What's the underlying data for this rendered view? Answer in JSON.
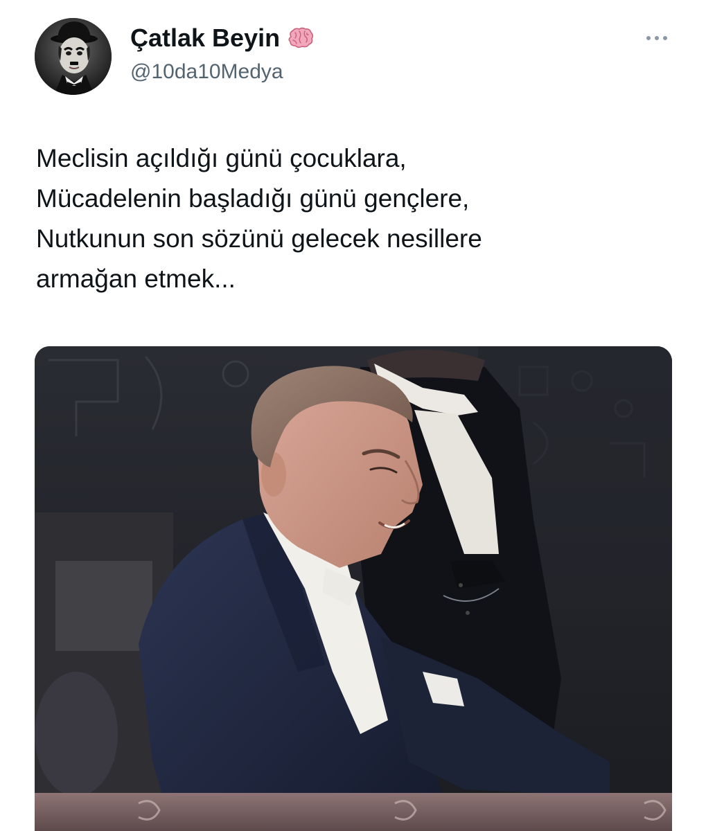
{
  "author": {
    "display_name": "Çatlak Beyin",
    "handle": "@10da10Medya",
    "avatar_icon": "avatar-photo",
    "badge_icon": "brain-icon"
  },
  "menu": {
    "more_icon": "more-horizontal-icon"
  },
  "tweet": {
    "lines": [
      "Meclisin açıldığı günü çocuklara,",
      "Mücadelenin başladığı günü gençlere,",
      "Nutkunun son sözünü gelecek nesillere",
      "armağan etmek..."
    ]
  },
  "media": {
    "type": "photo",
    "alt": "Colorized photo of a man in a dark tailcoat and white bow tie, smiling, seated in a balcony box; another man in formal dress stands behind him"
  },
  "colors": {
    "text_primary": "#0f1419",
    "text_secondary": "#536471",
    "brain_pink": "#e88aa6"
  }
}
